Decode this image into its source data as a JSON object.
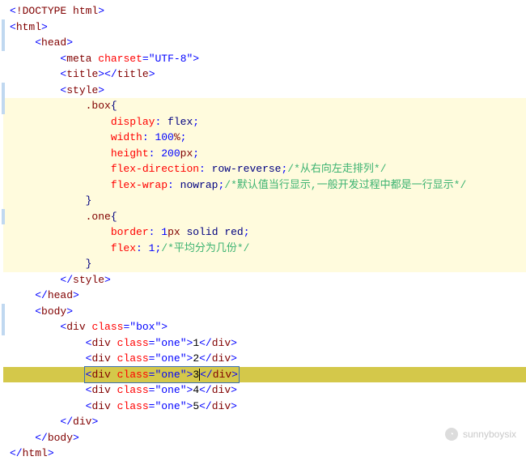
{
  "lines": [
    {
      "indent": 0,
      "kind": "tag_selfclose",
      "inner": "!DOCTYPE html",
      "bg": "plain"
    },
    {
      "indent": 0,
      "kind": "tag_open",
      "name": "html",
      "bg": "plain",
      "mark": true
    },
    {
      "indent": 1,
      "kind": "tag_open",
      "name": "head",
      "bg": "plain",
      "mark": true
    },
    {
      "indent": 2,
      "kind": "tag_attr",
      "name": "meta",
      "attrName": "charset",
      "attrVal": "UTF-8",
      "bg": "plain"
    },
    {
      "indent": 2,
      "kind": "tag_pair",
      "name": "title",
      "bg": "plain"
    },
    {
      "indent": 2,
      "kind": "tag_open",
      "name": "style",
      "bg": "plain",
      "mark": true
    },
    {
      "indent": 3,
      "kind": "sel_open",
      "sel": ".box",
      "bg": "soft",
      "mark": true
    },
    {
      "indent": 4,
      "kind": "prop",
      "prop": "display",
      "valKw": "flex",
      "bg": "soft"
    },
    {
      "indent": 4,
      "kind": "prop",
      "prop": "width",
      "valNum": "100",
      "valUnit": "%",
      "bg": "soft"
    },
    {
      "indent": 4,
      "kind": "prop",
      "prop": "height",
      "valNum": "200",
      "valUnit": "px",
      "bg": "soft"
    },
    {
      "indent": 4,
      "kind": "prop",
      "prop": "flex-direction",
      "valKw": "row-reverse",
      "comment": "/*从右向左走排列*/",
      "bg": "soft"
    },
    {
      "indent": 4,
      "kind": "prop",
      "prop": "flex-wrap",
      "valKw": "nowrap",
      "comment": "/*默认值当行显示,一般开发过程中都是一行显示*/",
      "bg": "soft"
    },
    {
      "indent": 3,
      "kind": "brace_close",
      "bg": "soft"
    },
    {
      "indent": 3,
      "kind": "sel_open",
      "sel": ".one",
      "bg": "soft",
      "mark": true
    },
    {
      "indent": 4,
      "kind": "prop_border",
      "prop": "border",
      "valNum": "1",
      "valUnit": "px",
      "valKw": "solid",
      "valKw2": "red",
      "bg": "soft"
    },
    {
      "indent": 4,
      "kind": "prop",
      "prop": "flex",
      "valNum": "1",
      "comment": "/*平均分为几份*/",
      "bg": "soft"
    },
    {
      "indent": 3,
      "kind": "brace_close",
      "bg": "soft"
    },
    {
      "indent": 2,
      "kind": "tag_close",
      "name": "style",
      "bg": "plain"
    },
    {
      "indent": 1,
      "kind": "tag_close",
      "name": "head",
      "bg": "plain"
    },
    {
      "indent": 1,
      "kind": "tag_open",
      "name": "body",
      "bg": "plain",
      "mark": true
    },
    {
      "indent": 2,
      "kind": "div_open",
      "cls": "box",
      "bg": "plain",
      "mark": true
    },
    {
      "indent": 3,
      "kind": "div_full",
      "cls": "one",
      "text": "1",
      "bg": "plain"
    },
    {
      "indent": 3,
      "kind": "div_full",
      "cls": "one",
      "text": "2",
      "bg": "plain"
    },
    {
      "indent": 3,
      "kind": "div_full",
      "cls": "one",
      "text": "3",
      "bg": "strong",
      "cursorAfterText": true
    },
    {
      "indent": 3,
      "kind": "div_full",
      "cls": "one",
      "text": "4",
      "bg": "plain"
    },
    {
      "indent": 3,
      "kind": "div_full",
      "cls": "one",
      "text": "5",
      "bg": "plain"
    },
    {
      "indent": 2,
      "kind": "tag_close",
      "name": "div",
      "bg": "plain"
    },
    {
      "indent": 1,
      "kind": "tag_close",
      "name": "body",
      "bg": "plain"
    },
    {
      "indent": 0,
      "kind": "tag_close",
      "name": "html",
      "bg": "plain"
    }
  ],
  "watermark": "sunnyboysix",
  "watermark_icon": "◔"
}
